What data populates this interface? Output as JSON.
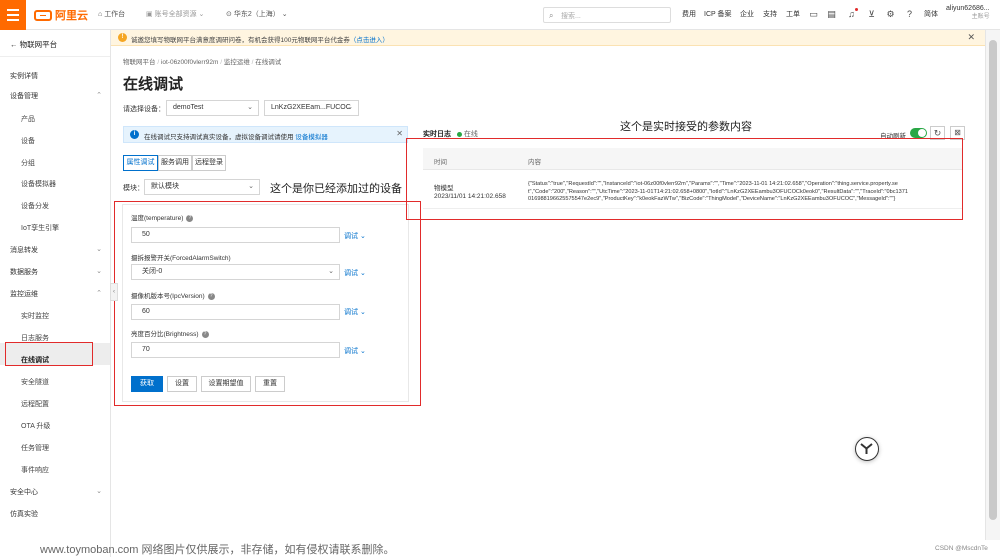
{
  "topbar": {
    "logo": "阿里云",
    "workbench": "工作台",
    "account": "账号全部资源",
    "region": "华东2（上海）",
    "search_placeholder": "搜索...",
    "links": [
      "费用",
      "ICP 备案",
      "企业",
      "支持",
      "工单"
    ],
    "lang": "简体",
    "user": "aliyun62686...",
    "role": "主账号"
  },
  "sidebar": {
    "back": "物联网平台",
    "items": [
      {
        "label": "实例详情",
        "level": "top"
      },
      {
        "label": "设备管理",
        "level": "top",
        "chev": "up"
      },
      {
        "label": "产品",
        "level": "sub"
      },
      {
        "label": "设备",
        "level": "sub"
      },
      {
        "label": "分组",
        "level": "sub"
      },
      {
        "label": "设备模拟器",
        "level": "sub"
      },
      {
        "label": "设备分发",
        "level": "sub"
      },
      {
        "label": "IoT孪生引擎",
        "level": "sub"
      },
      {
        "label": "消息转发",
        "level": "top",
        "chev": "down"
      },
      {
        "label": "数据服务",
        "level": "top",
        "chev": "down"
      },
      {
        "label": "监控运维",
        "level": "top",
        "chev": "up"
      },
      {
        "label": "实时监控",
        "level": "sub"
      },
      {
        "label": "日志服务",
        "level": "sub"
      },
      {
        "label": "在线调试",
        "level": "sub",
        "active": true
      },
      {
        "label": "安全隧道",
        "level": "sub"
      },
      {
        "label": "远程配置",
        "level": "sub"
      },
      {
        "label": "OTA 升级",
        "level": "sub"
      },
      {
        "label": "任务管理",
        "level": "sub"
      },
      {
        "label": "事件响应",
        "level": "sub"
      },
      {
        "label": "安全中心",
        "level": "top",
        "chev": "down"
      },
      {
        "label": "仿真实验",
        "level": "top"
      }
    ]
  },
  "notice": {
    "text": "诚邀您填写物联网平台满意度调研问卷，有机会获得100元物联网平台代金券",
    "link": "（点击进入）"
  },
  "breadcrumb": [
    "物联网平台",
    "iot-06z00f0vlerr92m",
    "监控运维",
    "在线调试"
  ],
  "page_title": "在线调试",
  "device_select": {
    "label": "请选择设备：",
    "product": "demoTest",
    "device": "LnKzG2XEEam...FUCOC"
  },
  "info_bar": {
    "text": "在线调试只支持调试真实设备，虚拟设备调试请使用",
    "link": "设备模拟器"
  },
  "tabs": [
    "属性调试",
    "服务调用",
    "远程登录"
  ],
  "module": {
    "label": "模块：",
    "value": "默认模块"
  },
  "annotations": {
    "device_added": "这个是你已经添加过的设备",
    "realtime_params": "这个是实时接受的参数内容"
  },
  "properties": [
    {
      "label": "温度(temperature)",
      "value": "50",
      "type": "input"
    },
    {
      "label": "摄拆报警开关(ForcedAlarmSwitch)",
      "value": "关闭-0",
      "type": "select"
    },
    {
      "label": "摄像机版本号(IpcVersion)",
      "value": "60",
      "type": "input"
    },
    {
      "label": "亮度百分比(Brightness)",
      "value": "70",
      "type": "input"
    }
  ],
  "debug_label": "调试",
  "actions": [
    "获取",
    "设置",
    "设置期望值",
    "重置"
  ],
  "log": {
    "title": "实时日志",
    "status": "在线",
    "auto_refresh": "自动刷新",
    "columns": [
      "时间",
      "内容"
    ],
    "rows": [
      {
        "type": "物模型",
        "time": "2023/11/01 14:21:02.658",
        "content_lines": [
          "{\"Status\":\"true\",\"RequestId\":\"\",\"InstanceId\":\"iot-06z00f0vlerr92m\",\"Params\":\"\",\"Time\":\"2023-11-01 14:21:02.658\",\"Operation\":\"thing.service.property.se",
          "t\",\"Code\":\"200\",\"Reason\":\"\",\"UtcTime\":\"2023-11-01T14:21:02.658+0800\",\"IotId\":\"LnKzG2XEEambu3OFUCOCk0eok0\",\"ResultData\":\"\",\"TraceId\":\"0bc1371",
          "016988196625575547e2ec9\",\"ProductKey\":\"k0eokFazWTw\",\"BizCode\":\"ThingModel\",\"DeviceName\":\"LnKzG2XEEambu3OFUCOC\",\"MessageId\":\"\"}"
        ]
      }
    ]
  },
  "watermark": "www.toymoban.com 网络图片仅供展示，非存储，如有侵权请联系删除。",
  "csdn": "CSDN @MscdnTe"
}
